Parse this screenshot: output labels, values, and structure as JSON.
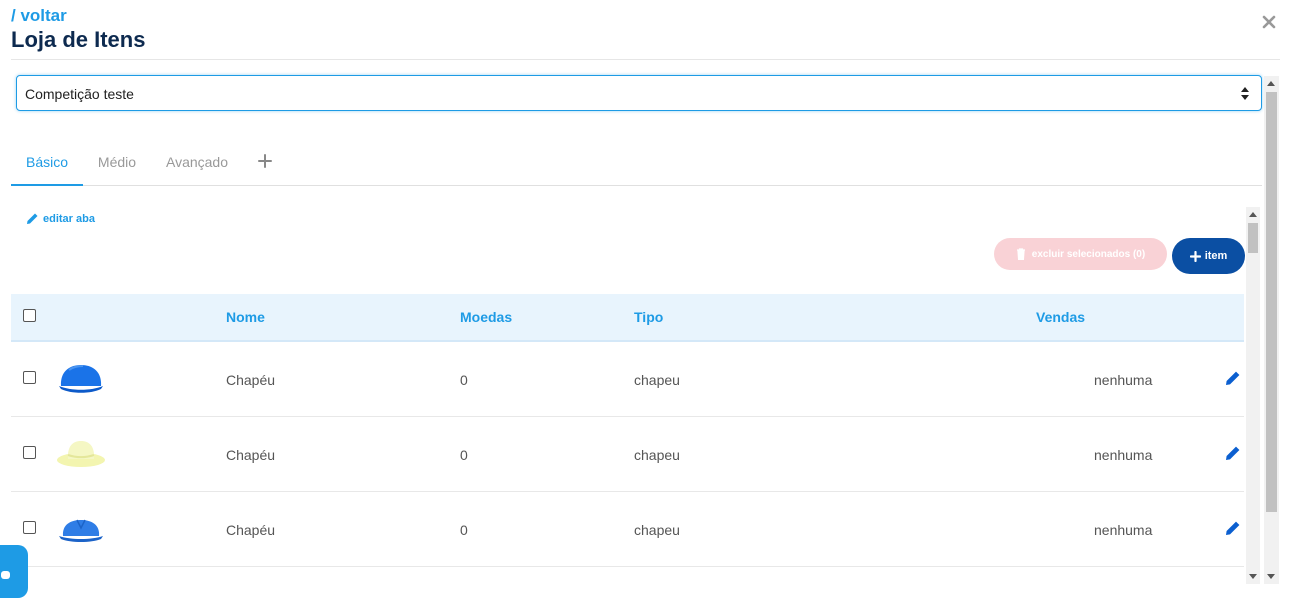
{
  "header": {
    "back_label": "/ voltar",
    "title": "Loja de Itens"
  },
  "competition_select": {
    "value": "Competição teste"
  },
  "tabs": [
    {
      "label": "Básico",
      "active": true
    },
    {
      "label": "Médio",
      "active": false
    },
    {
      "label": "Avançado",
      "active": false
    }
  ],
  "edit_tab_label": "editar aba",
  "actions": {
    "delete_selected_label": "excluir selecionados (0)",
    "add_item_label": "item"
  },
  "table": {
    "columns": [
      "Nome",
      "Moedas",
      "Tipo",
      "Vendas"
    ],
    "rows": [
      {
        "name": "Chapéu",
        "coins": "0",
        "type": "chapeu",
        "sales": "nenhuma",
        "image_color": "#1a73e8",
        "image": "cap-icon"
      },
      {
        "name": "Chapéu",
        "coins": "0",
        "type": "chapeu",
        "sales": "nenhuma",
        "image_color": "#f5f7b8",
        "image": "bucket-hat-icon"
      },
      {
        "name": "Chapéu",
        "coins": "0",
        "type": "chapeu",
        "sales": "nenhuma",
        "image_color": "#2f7de6",
        "image": "cap-icon"
      }
    ]
  },
  "colors": {
    "accent": "#1e9be5",
    "primary_button": "#0b4fa3",
    "danger_disabled": "#f9d2d6",
    "title": "#0d2a4f"
  }
}
